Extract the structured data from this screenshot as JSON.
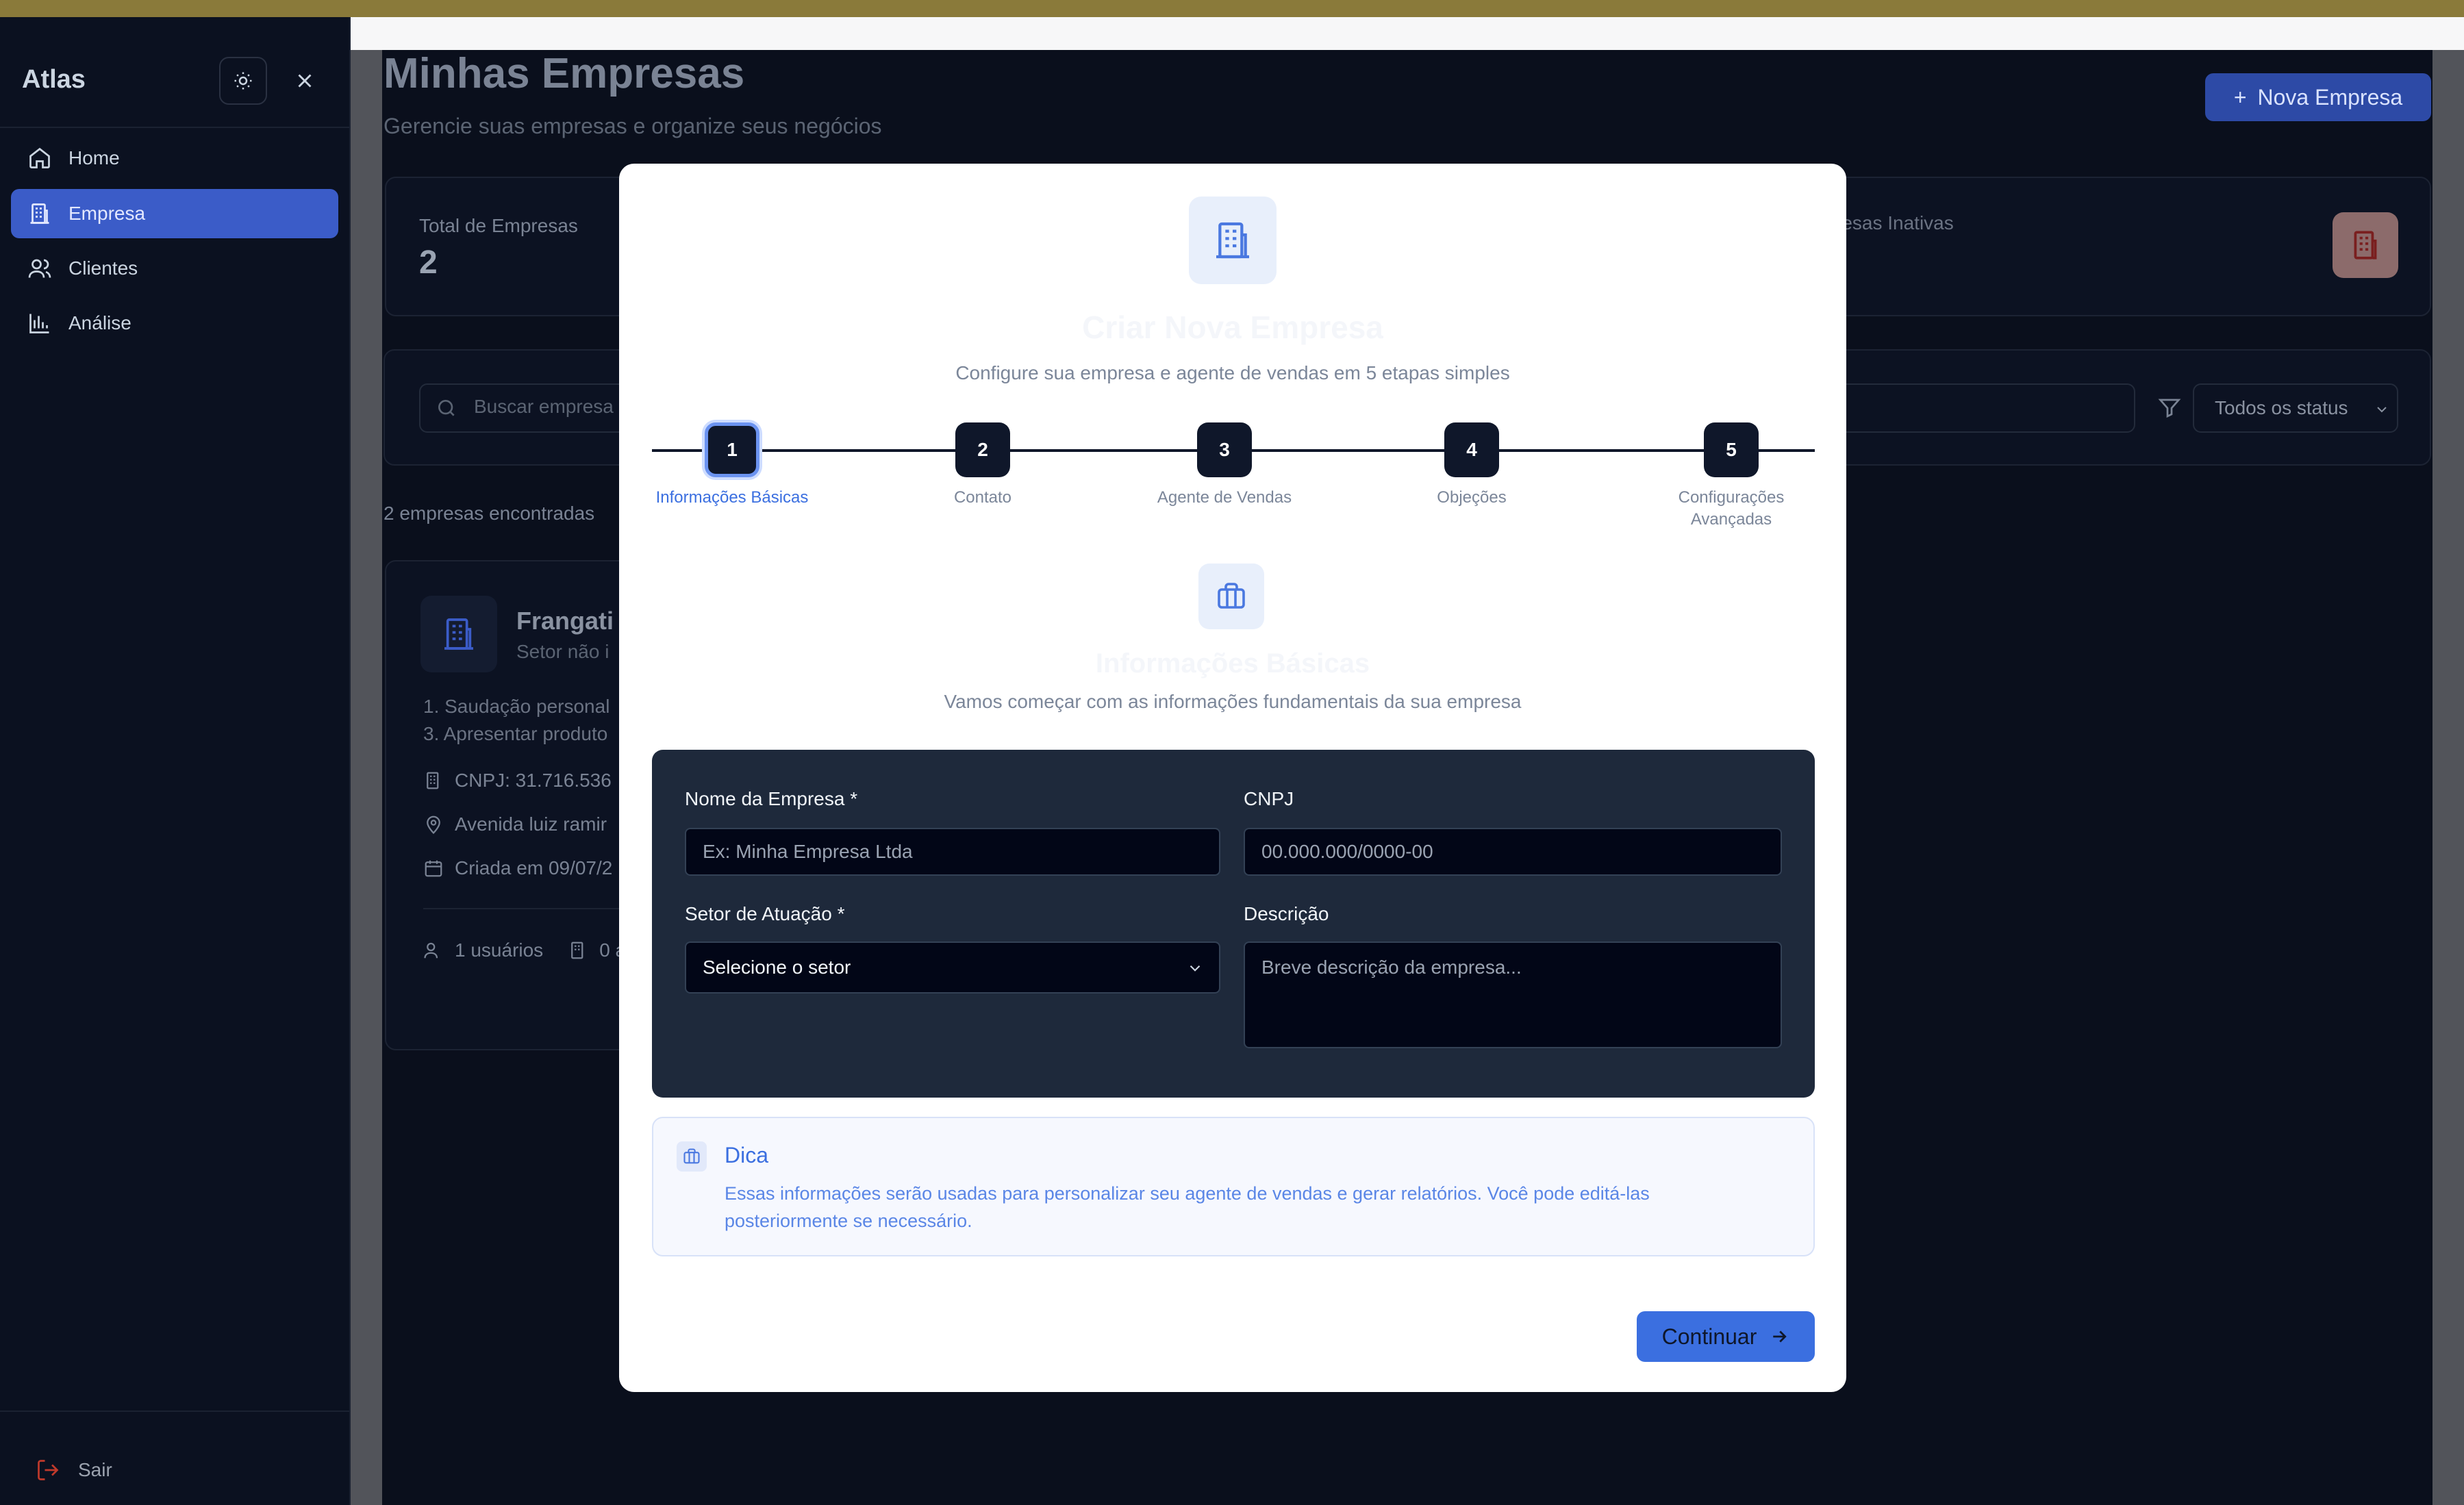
{
  "app": {
    "brand": "Atlas"
  },
  "sidebar": {
    "items": [
      {
        "label": "Home",
        "icon": "home-icon"
      },
      {
        "label": "Empresa",
        "icon": "building-icon",
        "active": true
      },
      {
        "label": "Clientes",
        "icon": "users-icon"
      },
      {
        "label": "Análise",
        "icon": "chart-icon"
      }
    ],
    "logout_label": "Sair"
  },
  "page": {
    "title": "Minhas Empresas",
    "subtitle": "Gerencie suas empresas e organize seus negócios",
    "new_button": "Nova Empresa"
  },
  "stats": {
    "total_label": "Total de Empresas",
    "total_value": "2",
    "inactive_label": "resas Inativas"
  },
  "filters": {
    "search_placeholder": "Buscar empresa",
    "status_value": "Todos os status"
  },
  "results": {
    "count_text": "2 empresas encontradas"
  },
  "company_card": {
    "name": "Frangati",
    "sector": "Setor não i",
    "line1": "1. Saudação personal",
    "line2": "3. Apresentar produto",
    "cnpj": "CNPJ: 31.716.536",
    "address": "Avenida luiz ramir",
    "created": "Criada em 09/07/2",
    "users": "1 usuários",
    "other": "0 a"
  },
  "modal": {
    "title": "Criar Nova Empresa",
    "subtitle": "Configure sua empresa e agente de vendas em 5 etapas simples",
    "steps": [
      {
        "number": "1",
        "label": "Informações Básicas"
      },
      {
        "number": "2",
        "label": "Contato"
      },
      {
        "number": "3",
        "label": "Agente de Vendas"
      },
      {
        "number": "4",
        "label": "Objeções"
      },
      {
        "number": "5",
        "label_line1": "Configurações",
        "label_line2": "Avançadas"
      }
    ],
    "active_step": 1,
    "section_title": "Informações Básicas",
    "section_subtitle": "Vamos começar com as informações fundamentais da sua empresa",
    "form": {
      "name_label": "Nome da Empresa *",
      "name_placeholder": "Ex: Minha Empresa Ltda",
      "cnpj_label": "CNPJ",
      "cnpj_placeholder": "00.000.000/0000-00",
      "sector_label": "Setor de Atuação *",
      "sector_value": "Selecione o setor",
      "description_label": "Descrição",
      "description_placeholder": "Breve descrição da empresa..."
    },
    "tip": {
      "title": "Dica",
      "text": "Essas informações serão usadas para personalizar seu agente de vendas e gerar relatórios. Você pode editá-las posteriormente se necessário."
    },
    "continue_label": "Continuar"
  },
  "colors": {
    "accent": "#3b6fe0",
    "sidebar_active": "#3b5cc8",
    "form_panel": "#1e293b",
    "step_bg": "#0f172a"
  }
}
